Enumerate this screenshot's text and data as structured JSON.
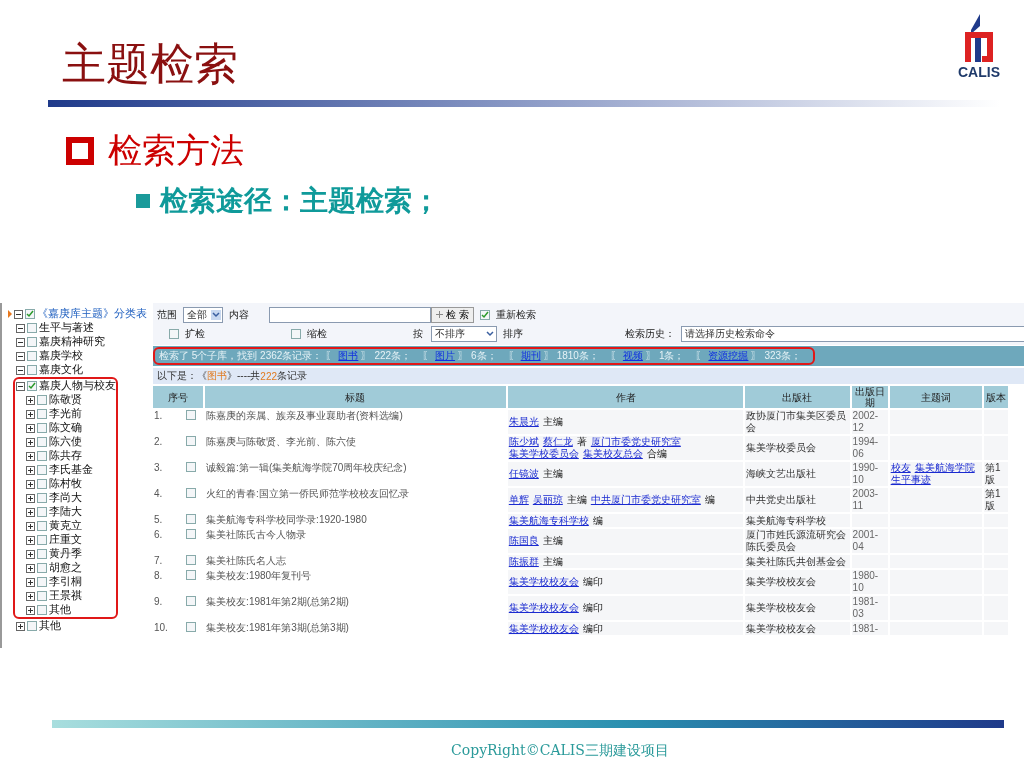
{
  "slide": {
    "title": "主题检索",
    "logo": {
      "text": "CALIS"
    },
    "bullets": [
      {
        "text": "检索方法",
        "children": [
          {
            "text": "检索途径：主题检索；"
          }
        ]
      }
    ]
  },
  "screenshot": {
    "tree": {
      "label": "《嘉庚库主题》分类表",
      "checked": true,
      "expanded": true,
      "children": [
        {
          "label": "生平与著述",
          "checked": false,
          "expanded": true
        },
        {
          "label": "嘉庚精神研究",
          "checked": false,
          "expanded": true
        },
        {
          "label": "嘉庚学校",
          "checked": false,
          "expanded": true
        },
        {
          "label": "嘉庚文化",
          "checked": false,
          "expanded": true
        },
        {
          "label": "嘉庚人物与校友",
          "checked": true,
          "expanded": true,
          "highlighted": true,
          "children": [
            {
              "label": "陈敬贤",
              "checked": false,
              "expanded": false
            },
            {
              "label": "李光前",
              "checked": false,
              "expanded": false
            },
            {
              "label": "陈文确",
              "checked": false,
              "expanded": false
            },
            {
              "label": "陈六使",
              "checked": false,
              "expanded": false
            },
            {
              "label": "陈共存",
              "checked": false,
              "expanded": false
            },
            {
              "label": "李氏基金",
              "checked": false,
              "expanded": false
            },
            {
              "label": "陈村牧",
              "checked": false,
              "expanded": false
            },
            {
              "label": "李尚大",
              "checked": false,
              "expanded": false
            },
            {
              "label": "李陆大",
              "checked": false,
              "expanded": false
            },
            {
              "label": "黄克立",
              "checked": false,
              "expanded": false
            },
            {
              "label": "庄重文",
              "checked": false,
              "expanded": false
            },
            {
              "label": "黄丹季",
              "checked": false,
              "expanded": false
            },
            {
              "label": "胡愈之",
              "checked": false,
              "expanded": false
            },
            {
              "label": "李引桐",
              "checked": false,
              "expanded": false
            },
            {
              "label": "王景祺",
              "checked": false,
              "expanded": false
            },
            {
              "label": "其他",
              "checked": false,
              "expanded": false
            }
          ]
        },
        {
          "label": "其他",
          "checked": false,
          "expanded": false
        }
      ]
    },
    "search": {
      "scope_label": "范围",
      "scope": "全部",
      "content_label": "内容",
      "button": "检 索",
      "rematch": {
        "label": "重新检索",
        "checked": true
      },
      "expand": {
        "label": "扩检",
        "checked": false
      },
      "narrow": {
        "label": "缩检",
        "checked": false
      },
      "sort_label": "按",
      "sort": "不排序",
      "sort_suffix": "排序",
      "history_label": "检索历史：",
      "history": "请选择历史检索命令"
    },
    "summary": {
      "highlighted": true,
      "text": "检索了 5个子库，找到 2362条记录：",
      "items": [
        {
          "left": "〖",
          "name": "图书",
          "right": "〗",
          "count": "222条；"
        },
        {
          "left": "〖",
          "name": "图片",
          "right": "〗",
          "count": "6条；"
        },
        {
          "left": "〖",
          "name": "期刊",
          "right": "〗",
          "count": "1810条；"
        },
        {
          "left": "〖",
          "name": "视频",
          "right": "〗",
          "count": "1条；"
        },
        {
          "left": "〖",
          "name": "资源挖掘",
          "right": "〗",
          "count": "323条；"
        }
      ]
    },
    "results_line": {
      "prefix": "以下是：《",
      "link": "图书",
      "middle": "》----共",
      "count": "222",
      "suffix": "条记录"
    },
    "table": {
      "columns": [
        "序号",
        "标题",
        "作者",
        "出版社",
        "出版日期",
        "主题词",
        "版本"
      ],
      "rows": [
        {
          "index": "1.",
          "checked": false,
          "title": "陈嘉庚的亲属、族亲及事业襄助者(资料选编)",
          "authors": [
            {
              "text": "朱晨光",
              "link": true
            },
            {
              "text": "主编",
              "link": false
            }
          ],
          "publisher": "政协厦门市集美区委员会",
          "date": "2002-12"
        },
        {
          "index": "2.",
          "checked": false,
          "title": "陈嘉庚与陈敬贤、李光前、陈六使",
          "authors": [
            {
              "text": "陈少斌",
              "link": true
            },
            {
              "text": "蔡仁龙",
              "link": true
            },
            {
              "text": "著",
              "link": false
            },
            {
              "text": "厦门市委党史研究室",
              "link": true
            },
            {
              "text": "集美学校委员会",
              "link": true
            },
            {
              "text": "集美校友总会",
              "link": true
            },
            {
              "text": "合编",
              "link": false
            }
          ],
          "publisher": "集美学校委员会",
          "date": "1994-06"
        },
        {
          "index": "3.",
          "checked": false,
          "title": "诚毅篇:第一辑(集美航海学院70周年校庆纪念)",
          "authors": [
            {
              "text": "任镜波",
              "link": true
            },
            {
              "text": "主编",
              "link": false
            }
          ],
          "publisher": "海峡文艺出版社",
          "date": "1990-10",
          "subjects": [
            "校友",
            "集美航海学院",
            "生平事迹"
          ],
          "edition": "第1版"
        },
        {
          "index": "4.",
          "checked": false,
          "title": "火红的青春:国立第一侨民师范学校校友回忆录",
          "authors": [
            {
              "text": "单辉",
              "link": true
            },
            {
              "text": "吴丽琼",
              "link": true
            },
            {
              "text": "主编",
              "link": false
            },
            {
              "text": "中共厦门市委党史研究室",
              "link": true
            },
            {
              "text": "编",
              "link": false
            }
          ],
          "publisher": "中共党史出版社",
          "date": "2003-11",
          "edition": "第1版"
        },
        {
          "index": "5.",
          "checked": false,
          "title": "集美航海专科学校同学录:1920-1980",
          "authors": [
            {
              "text": "集美航海专科学校",
              "link": true
            },
            {
              "text": "编",
              "link": false
            }
          ],
          "publisher": "集美航海专科学校"
        },
        {
          "index": "6.",
          "checked": false,
          "title": "集美社陈氏古今人物录",
          "authors": [
            {
              "text": "陈国良",
              "link": true
            },
            {
              "text": "主编",
              "link": false
            }
          ],
          "publisher": "厦门市姓氏源流研究会陈氏委员会",
          "date": "2001-04"
        },
        {
          "index": "7.",
          "checked": false,
          "title": "集美社陈氏名人志",
          "authors": [
            {
              "text": "陈振群",
              "link": true
            },
            {
              "text": "主编",
              "link": false
            }
          ],
          "publisher": "集美社陈氏共创基金会"
        },
        {
          "index": "8.",
          "checked": false,
          "title": "集美校友:1980年复刊号",
          "authors": [
            {
              "text": "集美学校校友会",
              "link": true
            },
            {
              "text": "编印",
              "link": false
            }
          ],
          "publisher": "集美学校校友会",
          "date": "1980-10"
        },
        {
          "index": "9.",
          "checked": false,
          "title": "集美校友:1981年第2期(总第2期)",
          "authors": [
            {
              "text": "集美学校校友会",
              "link": true
            },
            {
              "text": "编印",
              "link": false
            }
          ],
          "publisher": "集美学校校友会",
          "date": "1981-03"
        },
        {
          "index": "10.",
          "checked": false,
          "title": "集美校友:1981年第3期(总第3期)",
          "authors": [
            {
              "text": "集美学校校友会",
              "link": true
            },
            {
              "text": "编印",
              "link": false
            }
          ],
          "publisher": "集美学校校友会",
          "date": "1981-"
        }
      ]
    }
  },
  "footer": {
    "text": "CopyRight©CALIS三期建设项目"
  }
}
